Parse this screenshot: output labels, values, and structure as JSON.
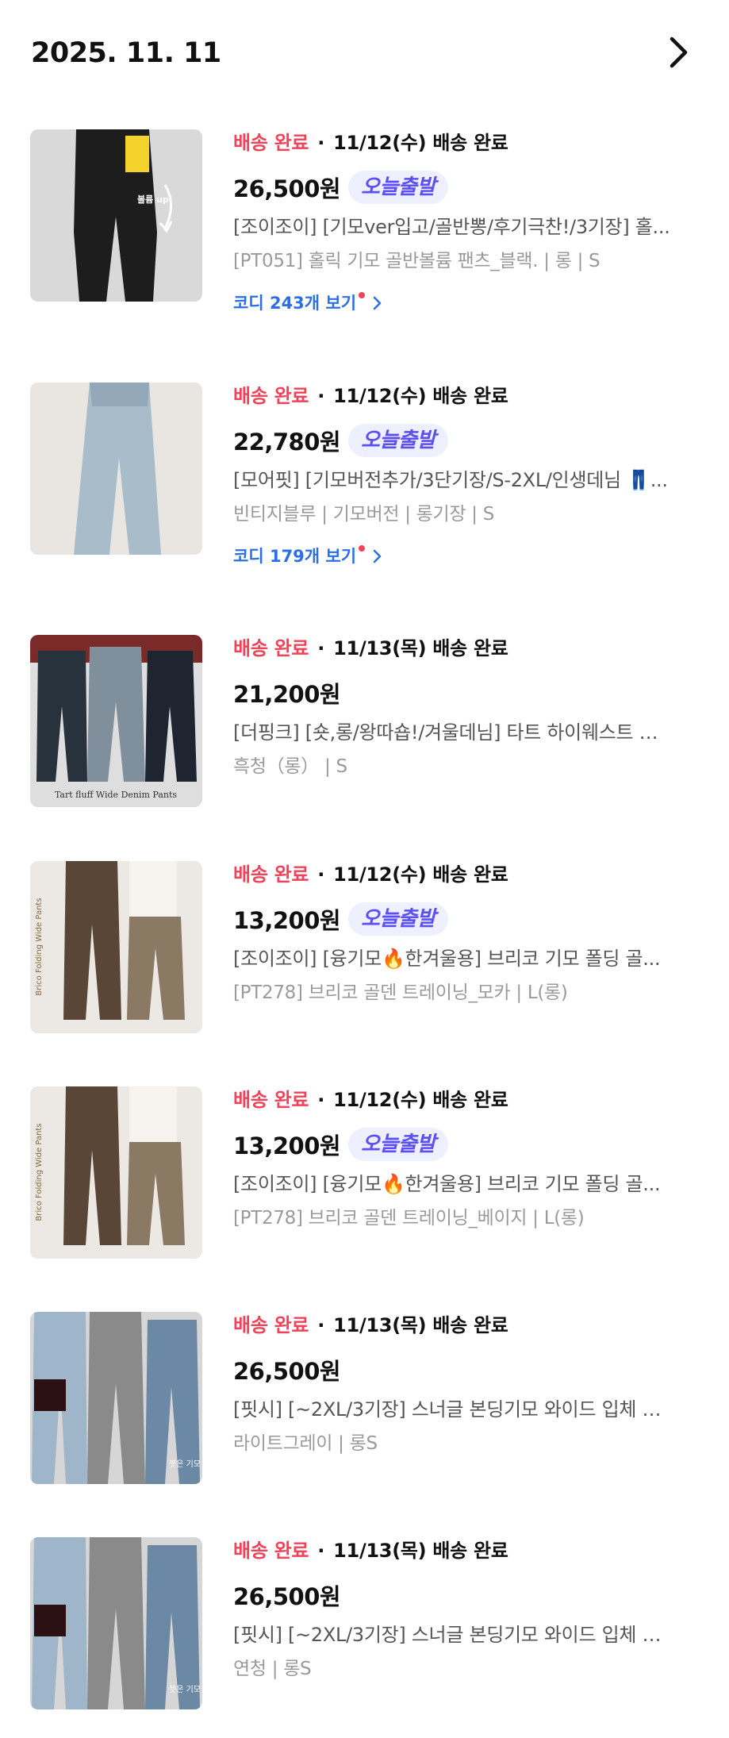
{
  "header": {
    "date": "2025. 11. 11"
  },
  "orders": [
    {
      "status": "배송 완료",
      "separator": "·",
      "delivery": "11/12(수) 배송 완료",
      "price": "26,500원",
      "badge": "오늘출발",
      "title": "[조이조이] [기모ver입고/골반뽕/후기극찬!/3기장] 홀...",
      "option": "[PT051] 홀릭 기모 골반볼륨 팬츠_블랙. | 롱 | S",
      "coordi": "코디 243개 보기",
      "image_text": "볼륨 up!"
    },
    {
      "status": "배송 완료",
      "separator": "·",
      "delivery": "11/12(수) 배송 완료",
      "price": "22,780원",
      "badge": "오늘출발",
      "title": "[모어핏] [기모버전추가/3단기장/S-2XL/인생데님 👖...",
      "option": "빈티지블루 | 기모버전 | 롱기장 | S",
      "coordi": "코디 179개 보기"
    },
    {
      "status": "배송 완료",
      "separator": "·",
      "delivery": "11/13(목) 배송 완료",
      "price": "21,200원",
      "title": "[더핑크] [숏,롱/왕따숍!/겨울데님] 타트 하이웨스트 기...",
      "option": "흑청（롱） | S",
      "image_text": "Tart fluff Wide Denim Pants"
    },
    {
      "status": "배송 완료",
      "separator": "·",
      "delivery": "11/12(수) 배송 완료",
      "price": "13,200원",
      "badge": "오늘출발",
      "title": "[조이조이] [융기모🔥한겨울용] 브리코 기모 폴딩 골...",
      "option": "[PT278] 브리코 골덴 트레이닝_모카 | L(롱)",
      "image_text": "Brico Folding Wide Pants"
    },
    {
      "status": "배송 완료",
      "separator": "·",
      "delivery": "11/12(수) 배송 완료",
      "price": "13,200원",
      "badge": "오늘출발",
      "title": "[조이조이] [융기모🔥한겨울용] 브리코 기모 폴딩 골...",
      "option": "[PT278] 브리코 골덴 트레이닝_베이지 | L(롱)",
      "image_text": "Brico Folding Wide Pants"
    },
    {
      "status": "배송 완료",
      "separator": "·",
      "delivery": "11/13(목) 배송 완료",
      "price": "26,500원",
      "title": "[핏시] [~2XL/3기장] 스너글 본딩기모 와이드 입체 일...",
      "option": "라이트그레이 | 롱S",
      "image_text": "붓은 기모"
    },
    {
      "status": "배송 완료",
      "separator": "·",
      "delivery": "11/13(목) 배송 완료",
      "price": "26,500원",
      "title": "[핏시] [~2XL/3기장] 스너글 본딩기모 와이드 입체 일...",
      "option": "연청 | 롱S",
      "image_text": "붓은 기모"
    }
  ],
  "colors": {
    "status_red": "#f0435a",
    "badge_bg": "#eef0ff",
    "badge_text": "#5b4ff2",
    "coordi_blue": "#2b6fe6"
  },
  "icons": {
    "header_next": "chevron-right-icon",
    "coordi_more": "chevron-right-icon",
    "new_dot": "red-dot-icon"
  }
}
